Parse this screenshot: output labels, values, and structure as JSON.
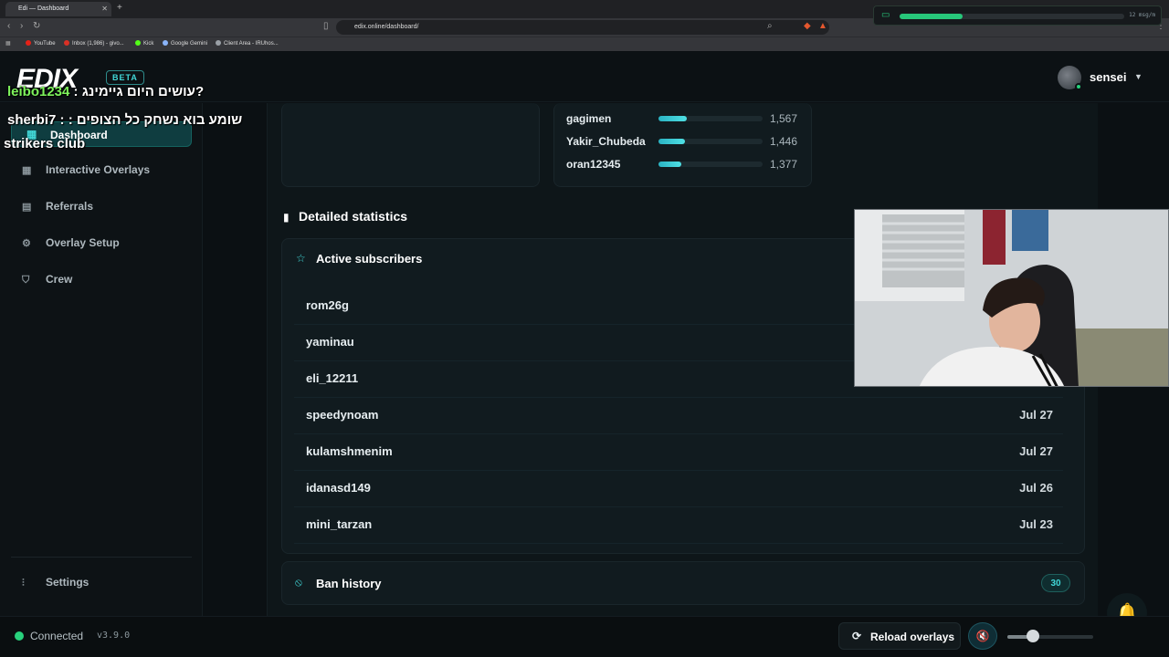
{
  "browser": {
    "tab_title": "Edi — Dashboard",
    "url": "edix.online/dashboard/",
    "bookmarks": [
      "YouTube",
      "Inbox (1,986) - givo...",
      "Kick",
      "Google Gemini",
      "Client Area - IRUhos..."
    ]
  },
  "stream_widget": {
    "rate": "12 msg/m",
    "level": 0.28
  },
  "header": {
    "logo": "EDIX",
    "badge": "BETA",
    "username": "sensei"
  },
  "chat_overlay": [
    {
      "user": "leibo1234",
      "text": " : עושים היום גיימינג?"
    },
    {
      "user": "sherbi7",
      "text": " : : שומע בוא נשחק כל הצופים"
    },
    {
      "user": "",
      "text": "strikers club"
    }
  ],
  "sidebar": {
    "active": "Dashboard",
    "items": [
      "Interactive Overlays",
      "Referrals",
      "Overlay Setup",
      "Crew"
    ],
    "settings": "Settings"
  },
  "leaderboard": [
    {
      "name": "gagimen",
      "value": "1,567",
      "ratio": 0.27
    },
    {
      "name": "Yakir_Chubeda",
      "value": "1,446",
      "ratio": 0.25
    },
    {
      "name": "oran12345",
      "value": "1,377",
      "ratio": 0.22
    }
  ],
  "stats": {
    "title": "Detailed statistics",
    "subscribers_title": "Active subscribers",
    "subscribers": [
      {
        "name": "rom26g",
        "date": ""
      },
      {
        "name": "yaminau",
        "date": ""
      },
      {
        "name": "eli_12211",
        "date": ""
      },
      {
        "name": "speedynoam",
        "date": "Jul 27"
      },
      {
        "name": "kulamshmenim",
        "date": "Jul 27"
      },
      {
        "name": "idanasd149",
        "date": "Jul 26"
      },
      {
        "name": "mini_tarzan",
        "date": "Jul 23"
      }
    ],
    "ban_title": "Ban history",
    "ban_count": "30"
  },
  "footer": {
    "status": "Connected",
    "version": "v3.9.0",
    "reload": "Reload overlays",
    "volume": 0.3
  },
  "colors": {
    "accent": "#41d7d7",
    "online": "#28d17c"
  }
}
